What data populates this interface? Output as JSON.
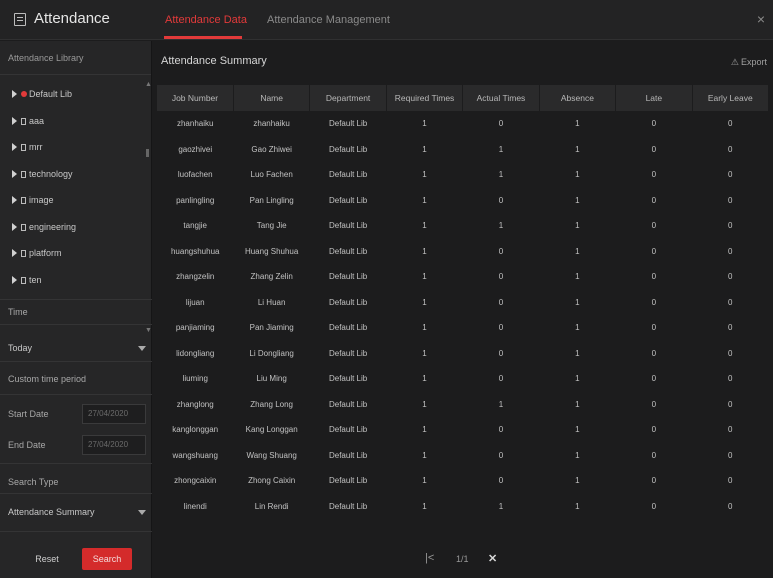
{
  "window": {
    "title": "Attendance",
    "tabs": [
      {
        "label": "Attendance Data",
        "active": true
      },
      {
        "label": "Attendance Management",
        "active": false
      }
    ],
    "close_glyph": "×"
  },
  "sidebar": {
    "library_header": "Attendance Library",
    "tree": [
      {
        "label": "Default Lib",
        "marked": true
      },
      {
        "label": "aaa"
      },
      {
        "label": "mrr"
      },
      {
        "label": "technology"
      },
      {
        "label": "image"
      },
      {
        "label": "engineering"
      },
      {
        "label": "platform"
      },
      {
        "label": "ten"
      }
    ],
    "time_label": "Time",
    "time_value": "Today",
    "custom_label": "Custom time period",
    "start_label": "Start Date",
    "start_value": "27/04/2020",
    "end_label": "End Date",
    "end_value": "27/04/2020",
    "search_type_label": "Search Type",
    "search_type_value": "Attendance Summary",
    "reset_label": "Reset",
    "search_label": "Search"
  },
  "main": {
    "title": "Attendance Summary",
    "export_label": "Export",
    "export_icon": "export-icon",
    "columns": [
      "Job Number",
      "Name",
      "Department",
      "Required Times",
      "Actual Times",
      "Absence",
      "Late",
      "Early Leave"
    ],
    "rows": [
      [
        "zhanhaiku",
        "zhanhaiku",
        "Default Lib",
        "1",
        "0",
        "1",
        "0",
        "0"
      ],
      [
        "gaozhivei",
        "Gao Zhiwei",
        "Default Lib",
        "1",
        "1",
        "1",
        "0",
        "0"
      ],
      [
        "luofachen",
        "Luo Fachen",
        "Default Lib",
        "1",
        "1",
        "1",
        "0",
        "0"
      ],
      [
        "panlingling",
        "Pan Lingling",
        "Default Lib",
        "1",
        "0",
        "1",
        "0",
        "0"
      ],
      [
        "tangjie",
        "Tang Jie",
        "Default Lib",
        "1",
        "1",
        "1",
        "0",
        "0"
      ],
      [
        "huangshuhua",
        "Huang Shuhua",
        "Default Lib",
        "1",
        "0",
        "1",
        "0",
        "0"
      ],
      [
        "zhangzelin",
        "Zhang Zelin",
        "Default Lib",
        "1",
        "0",
        "1",
        "0",
        "0"
      ],
      [
        "lijuan",
        "Li Huan",
        "Default Lib",
        "1",
        "0",
        "1",
        "0",
        "0"
      ],
      [
        "panjiaming",
        "Pan Jiaming",
        "Default Lib",
        "1",
        "0",
        "1",
        "0",
        "0"
      ],
      [
        "lidongliang",
        "Li Dongliang",
        "Default Lib",
        "1",
        "0",
        "1",
        "0",
        "0"
      ],
      [
        "liuming",
        "Liu Ming",
        "Default Lib",
        "1",
        "0",
        "1",
        "0",
        "0"
      ],
      [
        "zhanglong",
        "Zhang Long",
        "Default Lib",
        "1",
        "1",
        "1",
        "0",
        "0"
      ],
      [
        "kanglonggan",
        "Kang Longgan",
        "Default Lib",
        "1",
        "0",
        "1",
        "0",
        "0"
      ],
      [
        "wangshuang",
        "Wang Shuang",
        "Default Lib",
        "1",
        "0",
        "1",
        "0",
        "0"
      ],
      [
        "zhongcaixin",
        "Zhong Caixin",
        "Default Lib",
        "1",
        "0",
        "1",
        "0",
        "0"
      ],
      [
        "linendi",
        "Lin Rendi",
        "Default Lib",
        "1",
        "1",
        "1",
        "0",
        "0"
      ]
    ],
    "pager": {
      "first_glyph": "|<",
      "page_text": "1/1",
      "last_glyph": "✕"
    }
  },
  "colors": {
    "accent": "#e23a3a",
    "search_button": "#d42b2b",
    "background": "#1c1c1d",
    "sidebar": "#262627",
    "header_row": "#2a2a2b"
  }
}
